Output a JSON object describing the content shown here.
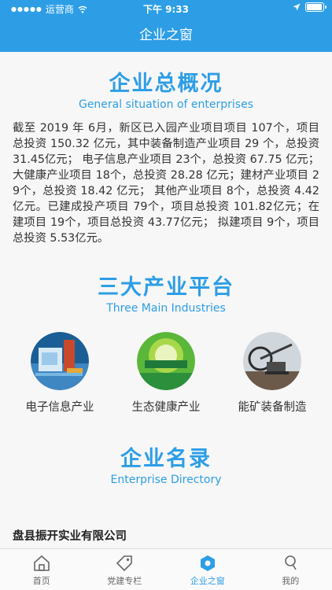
{
  "status_bar": {
    "carrier": "运营商",
    "time": "下午 9:33"
  },
  "nav": {
    "title": "企业之窗"
  },
  "overview": {
    "title": "企业总概况",
    "subtitle": "General situation of enterprises",
    "text": "截至 2019 年 6月，新区已入园产业项目项目 107个，项目总投资 150.32 亿元，其中装备制造产业项目 29 个，总投资 31.45亿元；  电子信息产业项目 23个，总投资 67.75 亿元；大健康产业项目 18个，总投资 28.28 亿元；建材产业项目 29个，总投资 18.42 亿元；  其他产业项目 8个，总投资 4.42亿元。已建成投产项目 79个，项目总投资 101.82亿元；在建项目 19个，项目总投资 43.77亿元；  拟建项目 9个，项目总投资 5.53亿元。"
  },
  "industries_section": {
    "title": "三大产业平台",
    "subtitle": "Three Main Industries",
    "items": [
      {
        "label": "电子信息产业",
        "icon": "circuit-board-image"
      },
      {
        "label": "生态健康产业",
        "icon": "eco-health-image"
      },
      {
        "label": "能矿装备制造",
        "icon": "mining-excavator-image"
      }
    ]
  },
  "directory": {
    "title": "企业名录",
    "subtitle": "Enterprise Directory",
    "first_company": "盘县振开实业有限公司"
  },
  "tabbar": {
    "items": [
      {
        "label": "首页",
        "icon": "home-icon"
      },
      {
        "label": "党建专栏",
        "icon": "tag-icon"
      },
      {
        "label": "企业之窗",
        "icon": "hexagon-icon"
      },
      {
        "label": "我的",
        "icon": "person-icon"
      }
    ],
    "active_index": 2
  },
  "colors": {
    "primary": "#2d9ee6",
    "background": "#f7f7f7"
  }
}
